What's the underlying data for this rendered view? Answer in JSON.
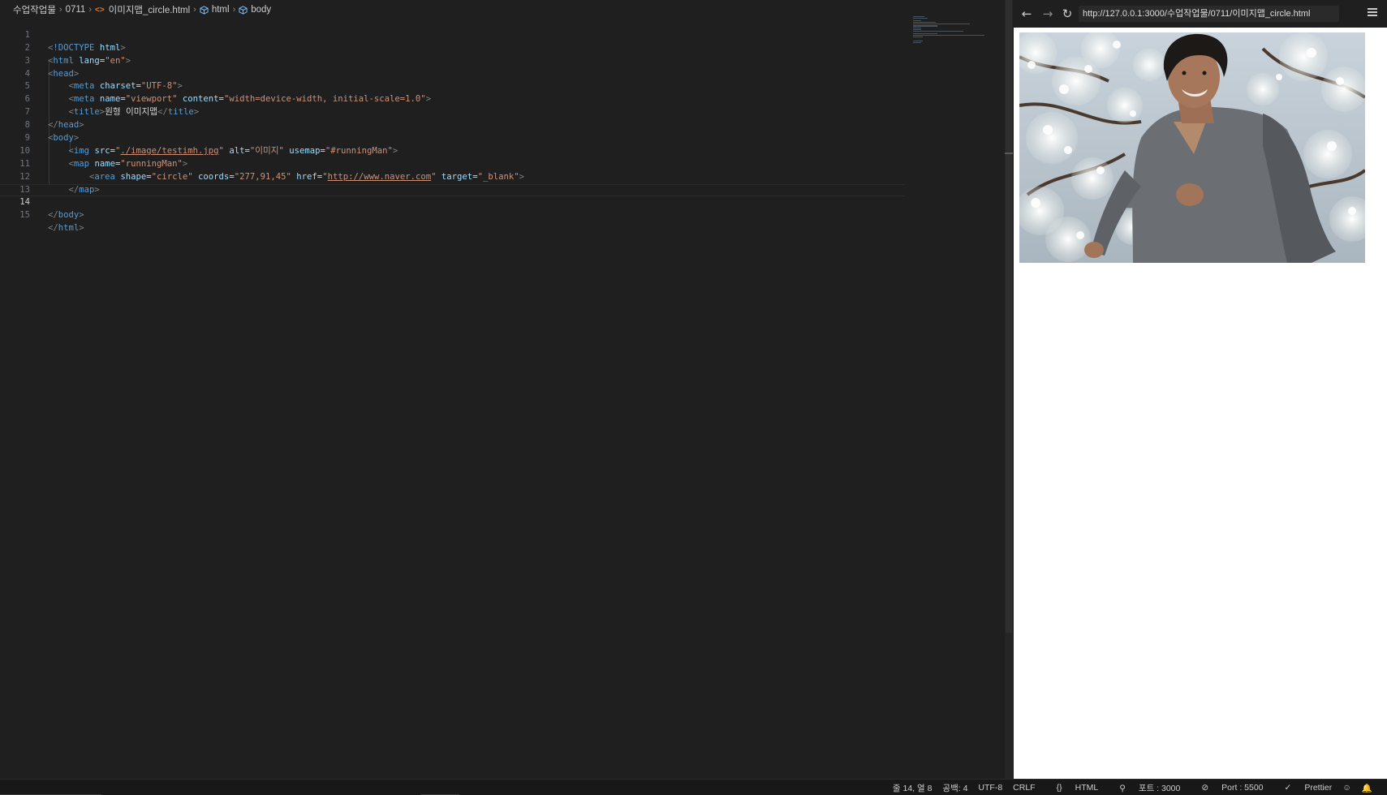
{
  "breadcrumb": {
    "folder": "수업작업물",
    "subfolder": "0711",
    "file": "이미지맵_circle.html",
    "node1": "html",
    "node2": "body"
  },
  "code": {
    "active_line": 14,
    "lines": [
      {
        "n": "1"
      },
      {
        "n": "2"
      },
      {
        "n": "3"
      },
      {
        "n": "4"
      },
      {
        "n": "5"
      },
      {
        "n": "6"
      },
      {
        "n": "7"
      },
      {
        "n": "8"
      },
      {
        "n": "9"
      },
      {
        "n": "10"
      },
      {
        "n": "11"
      },
      {
        "n": "12"
      },
      {
        "n": "13"
      },
      {
        "n": "14"
      },
      {
        "n": "15"
      }
    ],
    "tokens": {
      "doctype": "!DOCTYPE",
      "html": "html",
      "lang": "lang",
      "lang_val": "\"en\"",
      "head": "head",
      "meta": "meta",
      "charset": "charset",
      "charset_val": "\"UTF-8\"",
      "name": "name",
      "viewport_val": "\"viewport\"",
      "content": "content",
      "content_val": "\"width=device-width, initial-scale=1.0\"",
      "title": "title",
      "title_text": "원형 이미지맵",
      "body": "body",
      "img": "img",
      "src": "src",
      "src_val": "./image/testimh.jpg",
      "alt": "alt",
      "alt_val": "\"이미지\"",
      "usemap": "usemap",
      "usemap_val": "\"#runningMan\"",
      "map": "map",
      "map_name_val": "\"runningMan\"",
      "area": "area",
      "shape": "shape",
      "shape_val": "\"circle\"",
      "coords": "coords",
      "coords_val": "\"277,91,45\"",
      "href": "href",
      "href_val": "http://www.naver.com",
      "target": "target",
      "target_val": "\"_blank\""
    }
  },
  "preview": {
    "back_icon": "arrow-left-icon",
    "forward_icon": "arrow-right-icon",
    "reload_icon": "reload-icon",
    "url": "http://127.0.0.1:3000/수업작업물/0711/이미지맵_circle.html",
    "menu_icon": "hamburger-menu-icon",
    "image_alt": "이미지"
  },
  "statusbar": {
    "cursor": "줄 14, 열 8",
    "spaces": "공백: 4",
    "encoding": "UTF-8",
    "eol": "CRLF",
    "language": "HTML",
    "port_label": "포트 : 3000",
    "live_server": "Port : 5500",
    "prettier": "Prettier"
  },
  "colors": {
    "editor_bg": "#1f1f1f",
    "tag": "#569cd6",
    "attribute": "#9cdcfe",
    "string": "#ce9178",
    "bracket": "#808080"
  }
}
